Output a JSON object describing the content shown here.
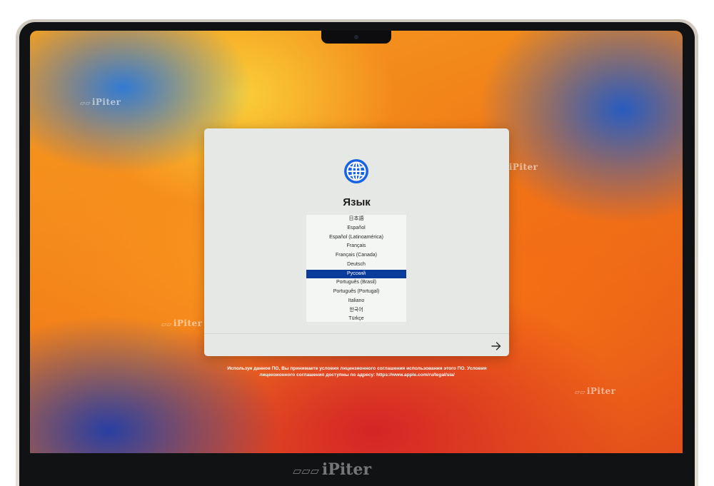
{
  "dialog": {
    "title": "Язык",
    "globe_icon": "globe-icon",
    "next_icon": "arrow-right-icon",
    "accent_color": "#0a3a9a",
    "languages": [
      {
        "label": "日本語",
        "selected": false
      },
      {
        "label": "Español",
        "selected": false
      },
      {
        "label": "Español (Latinoamérica)",
        "selected": false
      },
      {
        "label": "Français",
        "selected": false
      },
      {
        "label": "Français (Canada)",
        "selected": false
      },
      {
        "label": "Deutsch",
        "selected": false
      },
      {
        "label": "Русский",
        "selected": true
      },
      {
        "label": "Português (Brasil)",
        "selected": false
      },
      {
        "label": "Português (Portugal)",
        "selected": false
      },
      {
        "label": "Italiano",
        "selected": false
      },
      {
        "label": "한국어",
        "selected": false
      },
      {
        "label": "Türkçe",
        "selected": false
      }
    ]
  },
  "license": {
    "line1": "Используя данное ПО, Вы принимаете условия лицензионного соглашения использования этого ПО. Условия",
    "line2": "лицензионного соглашения доступны по адресу: https://www.apple.com/ru/legal/sla/"
  },
  "watermark": {
    "text": "iPiter"
  }
}
